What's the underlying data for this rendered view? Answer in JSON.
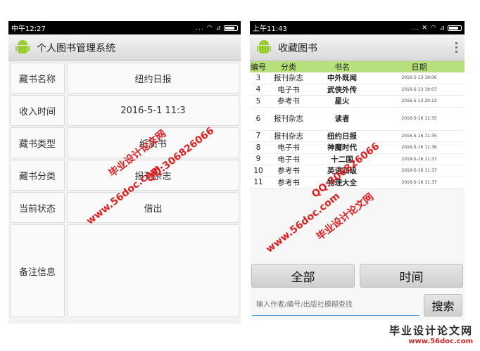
{
  "left": {
    "status_time": "中午12:27",
    "status_icons": "... ◠ ⊿",
    "app_title": "个人图书管理系统",
    "fields": [
      {
        "label": "藏书名称",
        "value": "纽约日报"
      },
      {
        "label": "收入时间",
        "value": "2016-5-1 11:3"
      },
      {
        "label": "藏书类型",
        "value": "纸质书"
      },
      {
        "label": "藏书分类",
        "value": "报刊杂志"
      },
      {
        "label": "当前状态",
        "value": "借出"
      },
      {
        "label": "备注信息",
        "value": ""
      }
    ]
  },
  "right": {
    "status_time": "上午11:43",
    "status_icons": "... ✕ ◠ ⊿",
    "app_title": "收藏图书",
    "table": {
      "headers": [
        "编号",
        "分类",
        "书名",
        "日期"
      ],
      "rows": [
        {
          "id": "3",
          "cat": "报刊杂志",
          "name": "中外既闻",
          "date": "2016-5-13 19:06"
        },
        {
          "id": "4",
          "cat": "电子书",
          "name": "武侠外传",
          "date": "2016-5-13 19:07"
        },
        {
          "id": "5",
          "cat": "参考书",
          "name": "星火",
          "date": "2016-5-13 20:13"
        },
        {
          "id": "6",
          "cat": "报刊杂志",
          "name": "读者",
          "date": "2016-5-16 11:35"
        },
        {
          "id": "7",
          "cat": "报刊杂志",
          "name": "纽约日报",
          "date": "2016-5-16 11:35"
        },
        {
          "id": "8",
          "cat": "电子书",
          "name": "神魔时代",
          "date": "2016-5-16 11:36"
        },
        {
          "id": "9",
          "cat": "电子书",
          "name": "十二国",
          "date": "2016-5-16 11:37"
        },
        {
          "id": "10",
          "cat": "参考书",
          "name": "英语四级",
          "date": "2016-5-16 11:37"
        },
        {
          "id": "11",
          "cat": "参考书",
          "name": "物理大全",
          "date": "2016-5-16 11:37"
        }
      ]
    },
    "btn_all": "全部",
    "btn_time": "时间",
    "search_placeholder": "输入作者/编号/出版社模糊查找",
    "btn_search": "搜索"
  },
  "watermark": {
    "cn": "毕业设计论文网",
    "url": "www.56doc.com",
    "qq": "QQ:306826066",
    "footer_cn": "毕业设计论文网",
    "footer_url": "www.56doc.com"
  },
  "colors": {
    "header_green": "#b7e07c",
    "android_green": "#9acd32",
    "watermark_red": "#e02020"
  }
}
